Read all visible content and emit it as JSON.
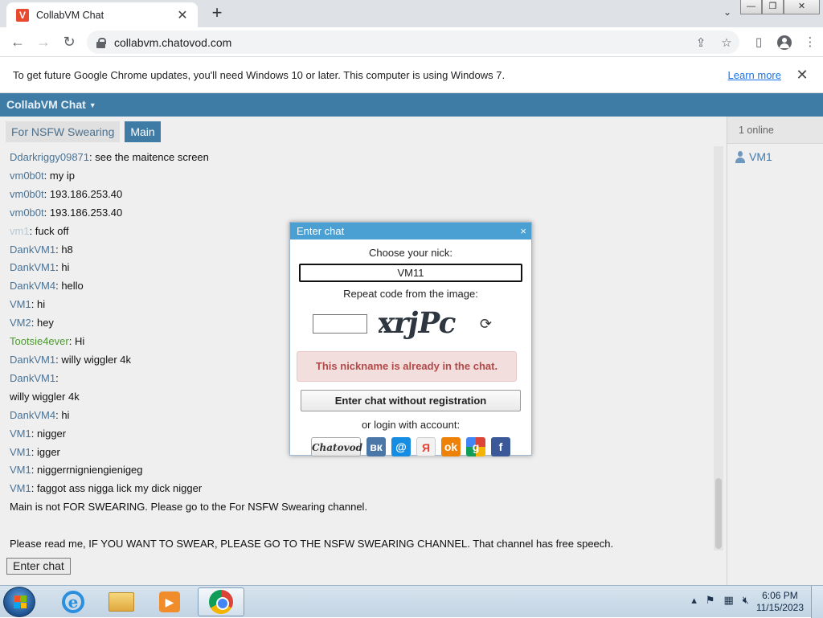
{
  "browser": {
    "tab_title": "CollabVM Chat",
    "tab_favicon": "V",
    "url": "collabvm.chatovod.com",
    "infobar_text": "To get future Google Chrome updates, you'll need Windows 10 or later. This computer is using Windows 7.",
    "infobar_link": "Learn more"
  },
  "app": {
    "title": "CollabVM Chat",
    "channels": [
      {
        "label": "For NSFW Swearing",
        "active": false
      },
      {
        "label": "Main",
        "active": true
      }
    ],
    "messages": [
      {
        "nick": "Ddarkriggy09871",
        "text": "see the maitence screen"
      },
      {
        "nick": "vm0b0t",
        "text": "my ip"
      },
      {
        "nick": "vm0b0t",
        "text": "193.186.253.40"
      },
      {
        "nick": "vm0b0t",
        "text": "193.186.253.40"
      },
      {
        "nick": "vm1",
        "text": "fuck off",
        "style": "faint"
      },
      {
        "nick": "DankVM1",
        "text": "h8"
      },
      {
        "nick": "DankVM1",
        "text": "hi"
      },
      {
        "nick": "DankVM4",
        "text": "hello"
      },
      {
        "nick": "VM1",
        "text": "hi"
      },
      {
        "nick": "VM2",
        "text": "hey"
      },
      {
        "nick": "Tootsie4ever",
        "text": "Hi",
        "style": "green"
      },
      {
        "nick": "DankVM1",
        "text": "willy wiggler 4k"
      },
      {
        "nick": "DankVM1",
        "text": ""
      },
      {
        "nick": "",
        "text": "willy wiggler 4k"
      },
      {
        "nick": "DankVM4",
        "text": "hi"
      },
      {
        "nick": "VM1",
        "text": "nigger"
      },
      {
        "nick": "VM1",
        "text": "igger"
      },
      {
        "nick": "VM1",
        "text": "niggerrnigniengienigeg"
      },
      {
        "nick": "VM1",
        "text": "faggot ass nigga lick my dick nigger"
      },
      {
        "nick": "",
        "text": "Main is not FOR SWEARING. Please go to the For NSFW Swearing channel."
      },
      {
        "nick": "",
        "text": ""
      },
      {
        "nick": "",
        "text": "Please read me, IF YOU WANT TO SWEAR, PLEASE GO TO THE NSFW SWEARING CHANNEL. That channel has free speech."
      }
    ],
    "enter_chat_label": "Enter chat",
    "online_count": "1 online",
    "users": [
      "VM1"
    ]
  },
  "modal": {
    "title": "Enter chat",
    "close": "×",
    "choose_nick_label": "Choose your nick:",
    "nick_value": "VM11",
    "repeat_code_label": "Repeat code from the image:",
    "captcha_text": "xrjPc",
    "captcha_value": "",
    "error": "This nickname is already in the chat.",
    "no_reg_button": "Enter chat without registration",
    "login_with": "or login with account:",
    "providers": [
      {
        "name": "chatovod",
        "label": "Chatovod",
        "color": "#e6e6e6"
      },
      {
        "name": "vk",
        "label": "вк",
        "color": "#4a76a8"
      },
      {
        "name": "mailru",
        "label": "@",
        "color": "#168de2"
      },
      {
        "name": "yandex",
        "label": "Я",
        "color": "#f2f2f2"
      },
      {
        "name": "odnoklassniki",
        "label": "ok",
        "color": "#ee8208"
      },
      {
        "name": "google",
        "label": "g",
        "color": "#4285f4"
      },
      {
        "name": "facebook",
        "label": "f",
        "color": "#3b5998"
      }
    ]
  },
  "taskbar": {
    "apps": [
      "internet-explorer",
      "file-explorer",
      "media-player",
      "chrome"
    ],
    "time": "6:06 PM",
    "date": "11/15/2023"
  }
}
